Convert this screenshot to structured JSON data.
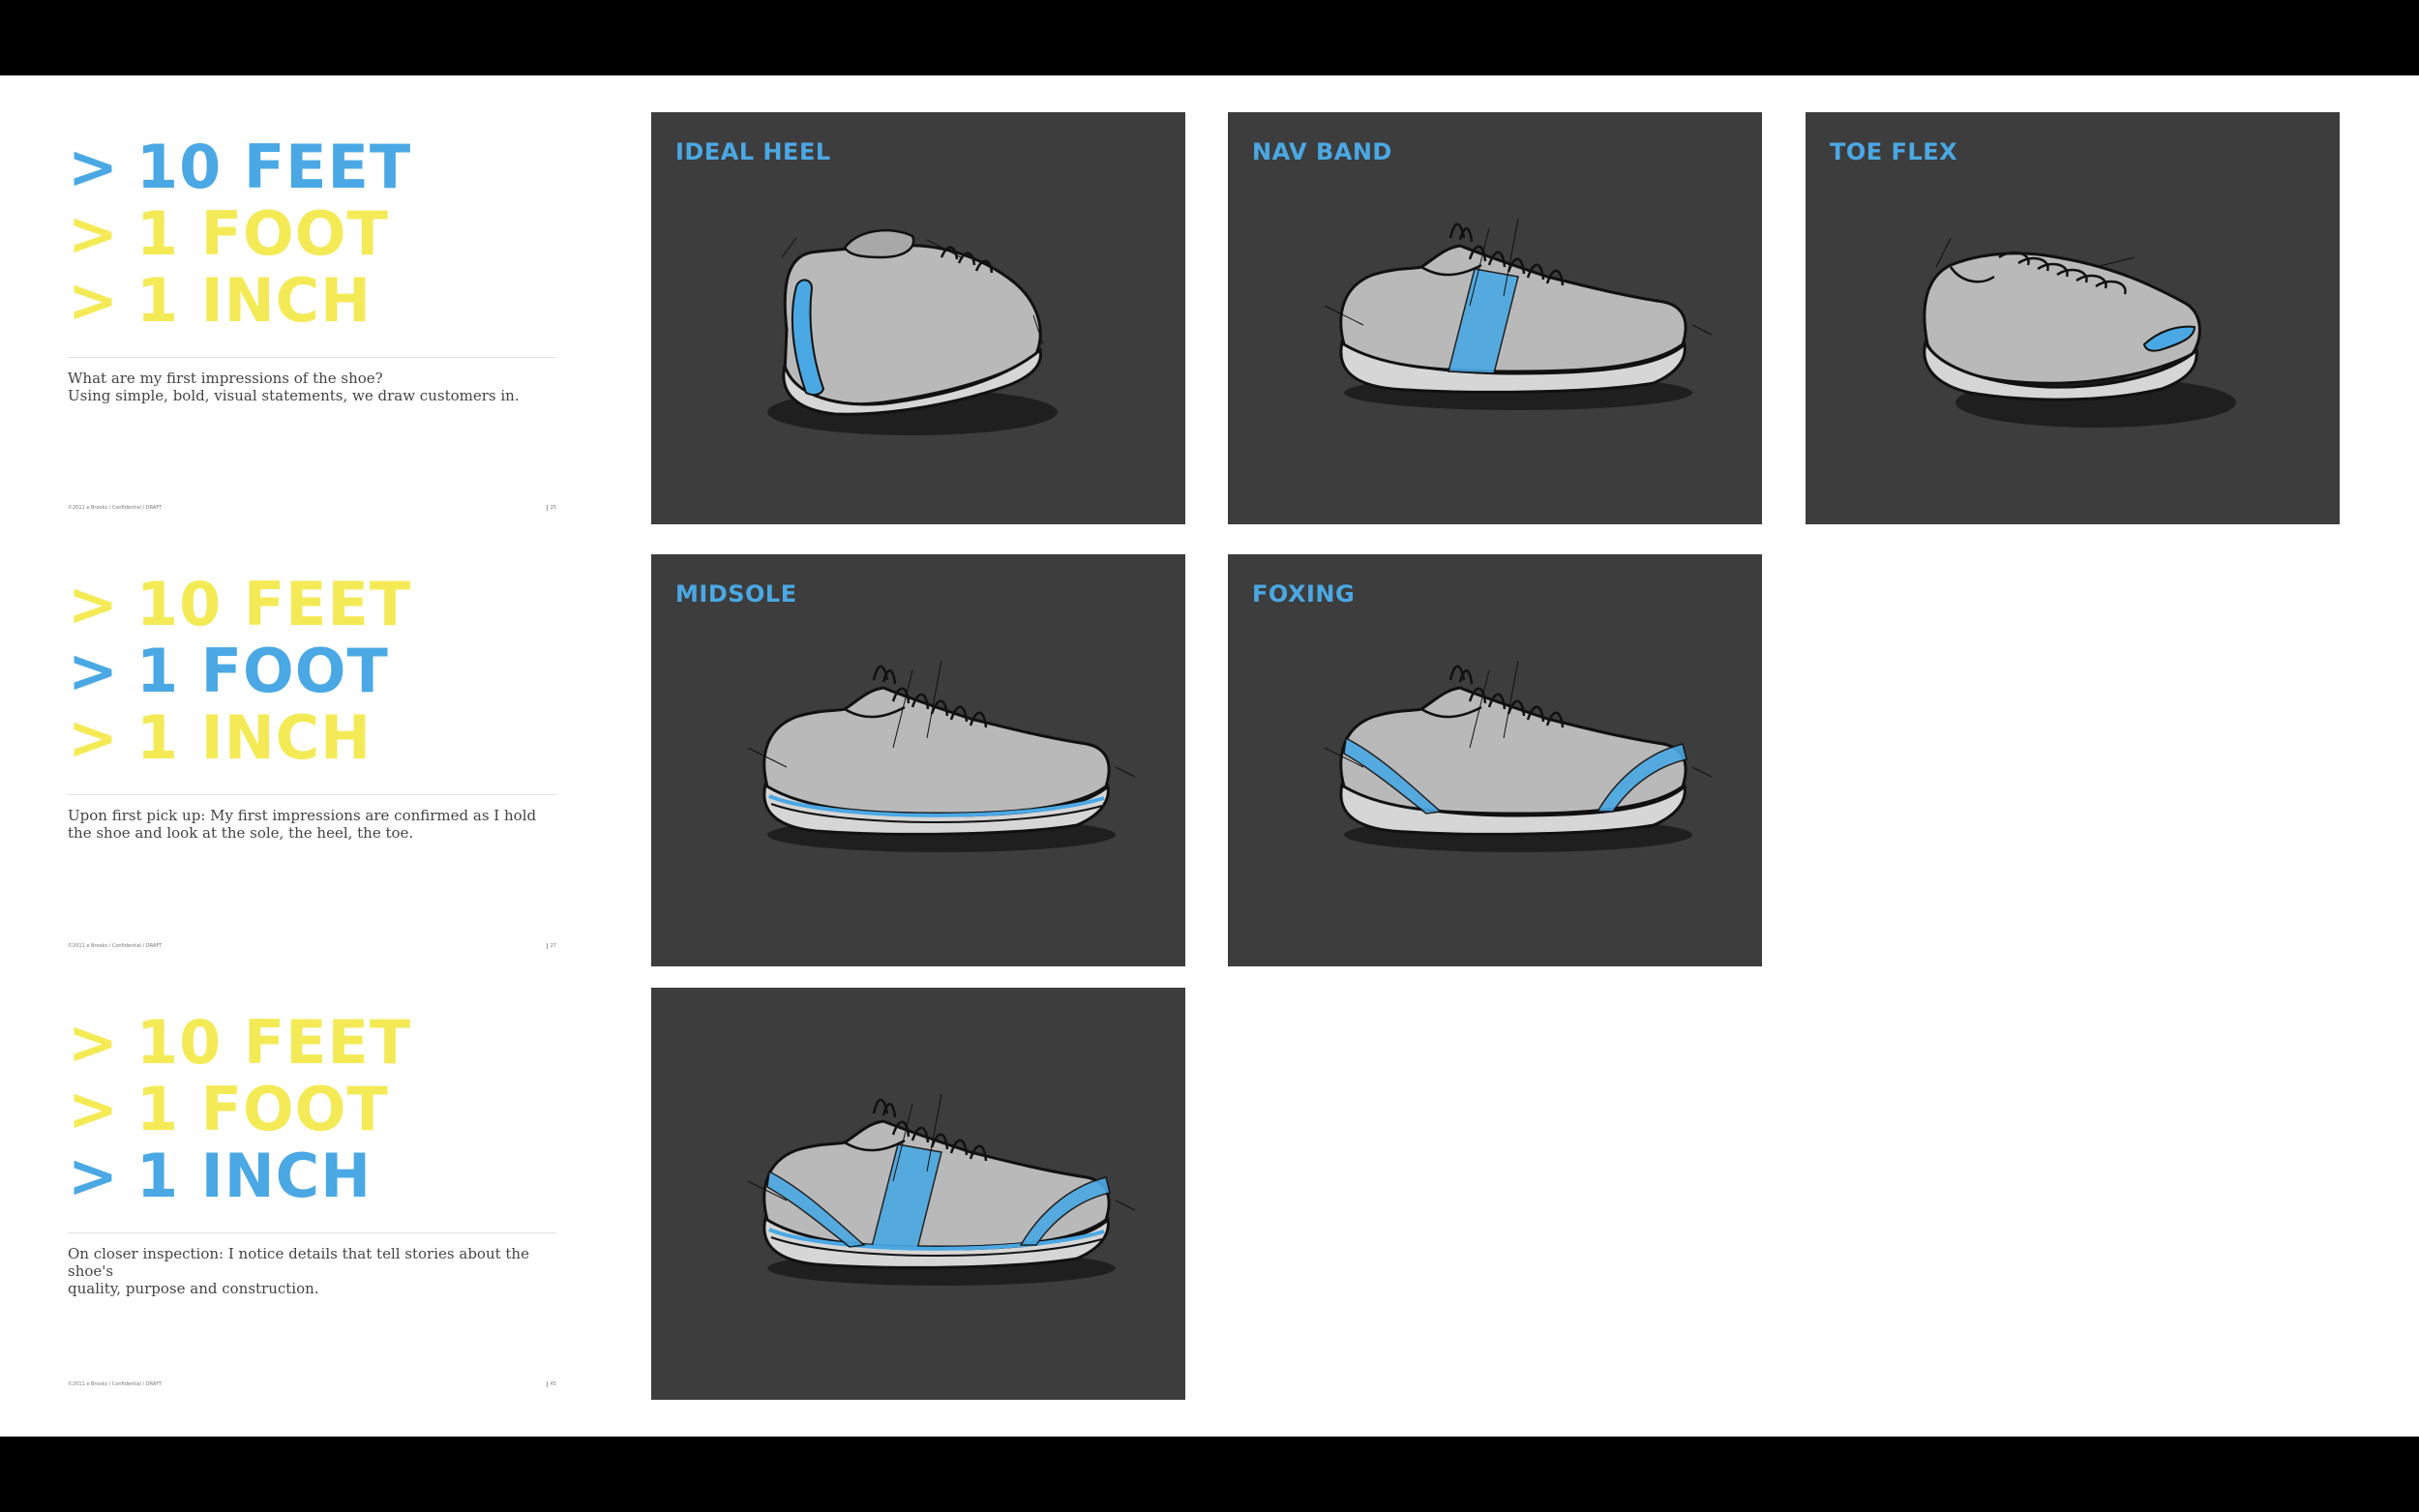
{
  "colors": {
    "blue": "#4aa8e4",
    "yellow": "#f4ea55",
    "panel": "#3d3d3d",
    "shoe": "#b9b9b9",
    "outline": "#111111"
  },
  "sections": [
    {
      "lines": [
        {
          "arrow": ">",
          "text": "10 FEET",
          "color": "blue"
        },
        {
          "arrow": ">",
          "text": "1 FOOT",
          "color": "yellow"
        },
        {
          "arrow": ">",
          "text": "1 INCH",
          "color": "yellow"
        }
      ],
      "description": "What are my first impressions of the shoe?\nUsing simple, bold, visual statements, we draw customers in.",
      "footer_left": "©2011 e Brooks / Confidential / DRAFT",
      "page": "25"
    },
    {
      "lines": [
        {
          "arrow": ">",
          "text": "10 FEET",
          "color": "yellow"
        },
        {
          "arrow": ">",
          "text": "1 FOOT",
          "color": "blue"
        },
        {
          "arrow": ">",
          "text": "1 INCH",
          "color": "yellow"
        }
      ],
      "description": "Upon first pick up: My first impressions are confirmed as I hold\nthe shoe and look at the sole, the heel, the toe.",
      "footer_left": "©2011 e Brooks / Confidential / DRAFT",
      "page": "27"
    },
    {
      "lines": [
        {
          "arrow": ">",
          "text": "10 FEET",
          "color": "yellow"
        },
        {
          "arrow": ">",
          "text": "1 FOOT",
          "color": "yellow"
        },
        {
          "arrow": ">",
          "text": "1 INCH",
          "color": "blue"
        }
      ],
      "description": "On closer inspection: I notice details that tell stories about the shoe's\nquality, purpose and construction.",
      "footer_left": "©2011 e Brooks / Confidential / DRAFT",
      "page": "45"
    }
  ],
  "panels": [
    {
      "label": "IDEAL HEEL",
      "view": "heel",
      "highlight": "heel"
    },
    {
      "label": "NAV BAND",
      "view": "side",
      "highlight": "band"
    },
    {
      "label": "TOE FLEX",
      "view": "toe",
      "highlight": "toe"
    },
    {
      "label": "MIDSOLE",
      "view": "side",
      "highlight": "midsole"
    },
    {
      "label": "FOXING",
      "view": "side",
      "highlight": "foxing"
    },
    {
      "label": "",
      "view": "side",
      "highlight": "all"
    }
  ]
}
